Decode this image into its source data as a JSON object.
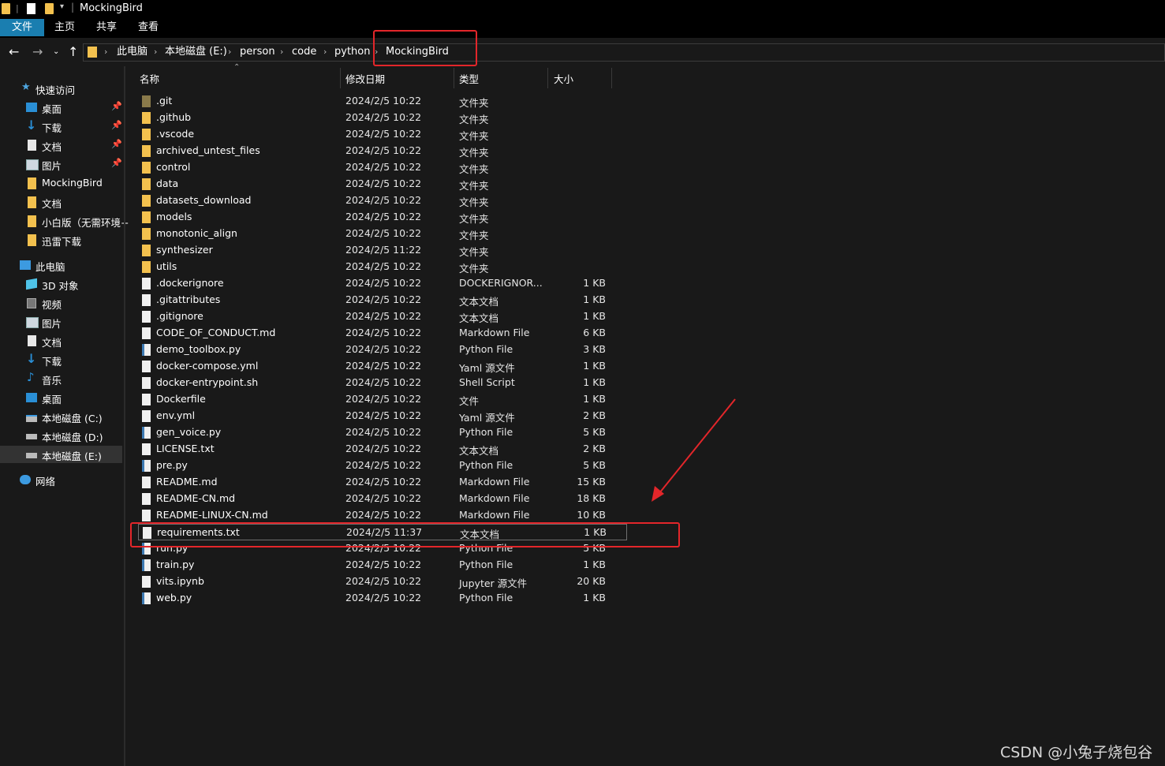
{
  "window": {
    "title": "MockingBird"
  },
  "ribbon": {
    "tabs": [
      "文件",
      "主页",
      "共享",
      "查看"
    ]
  },
  "address": {
    "breadcrumbs": [
      "此电脑",
      "本地磁盘 (E:)",
      "person",
      "code",
      "python",
      "MockingBird"
    ]
  },
  "sidebar": {
    "quick_access": "快速访问",
    "quick_items": [
      {
        "label": "桌面",
        "icon": "desktop-icon",
        "pinned": true
      },
      {
        "label": "下载",
        "icon": "download-icon",
        "pinned": true
      },
      {
        "label": "文档",
        "icon": "document-icon",
        "pinned": true
      },
      {
        "label": "图片",
        "icon": "picture-icon",
        "pinned": true
      },
      {
        "label": "MockingBird",
        "icon": "folder-icon",
        "pinned": false
      },
      {
        "label": "文档",
        "icon": "folder-icon",
        "pinned": false
      },
      {
        "label": "小白版（无需环境+",
        "icon": "folder-icon",
        "pinned": false
      },
      {
        "label": "迅雷下载",
        "icon": "folder-icon",
        "pinned": false
      }
    ],
    "this_pc": "此电脑",
    "pc_items": [
      {
        "label": "3D 对象",
        "icon": "cube-icon"
      },
      {
        "label": "视频",
        "icon": "video-icon"
      },
      {
        "label": "图片",
        "icon": "picture-icon"
      },
      {
        "label": "文档",
        "icon": "document-icon"
      },
      {
        "label": "下载",
        "icon": "download-icon"
      },
      {
        "label": "音乐",
        "icon": "music-icon"
      },
      {
        "label": "桌面",
        "icon": "desktop-icon"
      },
      {
        "label": "本地磁盘 (C:)",
        "icon": "drive-icon"
      },
      {
        "label": "本地磁盘 (D:)",
        "icon": "drive-icon"
      },
      {
        "label": "本地磁盘 (E:)",
        "icon": "drive-icon"
      }
    ],
    "network": "网络"
  },
  "columns": {
    "name": "名称",
    "date": "修改日期",
    "type": "类型",
    "size": "大小"
  },
  "files": [
    {
      "name": ".git",
      "date": "2024/2/5 10:22",
      "type": "文件夹",
      "size": "",
      "kind": "folder-dark"
    },
    {
      "name": ".github",
      "date": "2024/2/5 10:22",
      "type": "文件夹",
      "size": "",
      "kind": "folder"
    },
    {
      "name": ".vscode",
      "date": "2024/2/5 10:22",
      "type": "文件夹",
      "size": "",
      "kind": "folder"
    },
    {
      "name": "archived_untest_files",
      "date": "2024/2/5 10:22",
      "type": "文件夹",
      "size": "",
      "kind": "folder"
    },
    {
      "name": "control",
      "date": "2024/2/5 10:22",
      "type": "文件夹",
      "size": "",
      "kind": "folder"
    },
    {
      "name": "data",
      "date": "2024/2/5 10:22",
      "type": "文件夹",
      "size": "",
      "kind": "folder"
    },
    {
      "name": "datasets_download",
      "date": "2024/2/5 10:22",
      "type": "文件夹",
      "size": "",
      "kind": "folder"
    },
    {
      "name": "models",
      "date": "2024/2/5 10:22",
      "type": "文件夹",
      "size": "",
      "kind": "folder"
    },
    {
      "name": "monotonic_align",
      "date": "2024/2/5 10:22",
      "type": "文件夹",
      "size": "",
      "kind": "folder"
    },
    {
      "name": "synthesizer",
      "date": "2024/2/5 11:22",
      "type": "文件夹",
      "size": "",
      "kind": "folder"
    },
    {
      "name": "utils",
      "date": "2024/2/5 10:22",
      "type": "文件夹",
      "size": "",
      "kind": "folder"
    },
    {
      "name": ".dockerignore",
      "date": "2024/2/5 10:22",
      "type": "DOCKERIGNOR...",
      "size": "1 KB",
      "kind": "file"
    },
    {
      "name": ".gitattributes",
      "date": "2024/2/5 10:22",
      "type": "文本文档",
      "size": "1 KB",
      "kind": "file"
    },
    {
      "name": ".gitignore",
      "date": "2024/2/5 10:22",
      "type": "文本文档",
      "size": "1 KB",
      "kind": "file"
    },
    {
      "name": "CODE_OF_CONDUCT.md",
      "date": "2024/2/5 10:22",
      "type": "Markdown File",
      "size": "6 KB",
      "kind": "file"
    },
    {
      "name": "demo_toolbox.py",
      "date": "2024/2/5 10:22",
      "type": "Python File",
      "size": "3 KB",
      "kind": "py"
    },
    {
      "name": "docker-compose.yml",
      "date": "2024/2/5 10:22",
      "type": "Yaml 源文件",
      "size": "1 KB",
      "kind": "file"
    },
    {
      "name": "docker-entrypoint.sh",
      "date": "2024/2/5 10:22",
      "type": "Shell Script",
      "size": "1 KB",
      "kind": "file"
    },
    {
      "name": "Dockerfile",
      "date": "2024/2/5 10:22",
      "type": "文件",
      "size": "1 KB",
      "kind": "file"
    },
    {
      "name": "env.yml",
      "date": "2024/2/5 10:22",
      "type": "Yaml 源文件",
      "size": "2 KB",
      "kind": "file"
    },
    {
      "name": "gen_voice.py",
      "date": "2024/2/5 10:22",
      "type": "Python File",
      "size": "5 KB",
      "kind": "py"
    },
    {
      "name": "LICENSE.txt",
      "date": "2024/2/5 10:22",
      "type": "文本文档",
      "size": "2 KB",
      "kind": "file"
    },
    {
      "name": "pre.py",
      "date": "2024/2/5 10:22",
      "type": "Python File",
      "size": "5 KB",
      "kind": "py"
    },
    {
      "name": "README.md",
      "date": "2024/2/5 10:22",
      "type": "Markdown File",
      "size": "15 KB",
      "kind": "file"
    },
    {
      "name": "README-CN.md",
      "date": "2024/2/5 10:22",
      "type": "Markdown File",
      "size": "18 KB",
      "kind": "file"
    },
    {
      "name": "README-LINUX-CN.md",
      "date": "2024/2/5 10:22",
      "type": "Markdown File",
      "size": "10 KB",
      "kind": "file"
    },
    {
      "name": "requirements.txt",
      "date": "2024/2/5 11:37",
      "type": "文本文档",
      "size": "1 KB",
      "kind": "file",
      "selected": true
    },
    {
      "name": "run.py",
      "date": "2024/2/5 10:22",
      "type": "Python File",
      "size": "5 KB",
      "kind": "py"
    },
    {
      "name": "train.py",
      "date": "2024/2/5 10:22",
      "type": "Python File",
      "size": "1 KB",
      "kind": "py"
    },
    {
      "name": "vits.ipynb",
      "date": "2024/2/5 10:22",
      "type": "Jupyter 源文件",
      "size": "20 KB",
      "kind": "file"
    },
    {
      "name": "web.py",
      "date": "2024/2/5 10:22",
      "type": "Python File",
      "size": "1 KB",
      "kind": "py"
    }
  ],
  "watermark": "CSDN @小兔子烧包谷",
  "colors": {
    "accent": "#1a7eb0",
    "annotation": "#e3262a",
    "folder": "#f3c14e"
  }
}
